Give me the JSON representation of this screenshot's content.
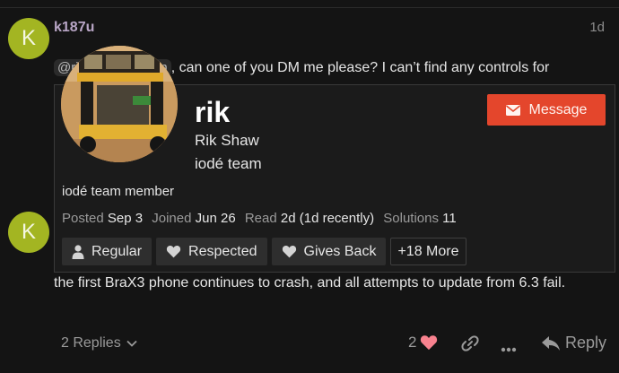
{
  "post1": {
    "avatar_letter": "K",
    "username": "k187u",
    "date": "1d",
    "mention": "@rik",
    "mention_tail": "men",
    "text": ", can one of you DM me please? I can’t find any controls for"
  },
  "post2": {
    "avatar_letter": "K",
    "text": "the first BraX3 phone continues to crash, and all attempts to update from 6.3 fail."
  },
  "user_card": {
    "username": "rik",
    "full_name": "Rik Shaw",
    "title": "iodé team",
    "bio": "iodé team member",
    "message_label": "Message",
    "meta": {
      "posted_label": "Posted",
      "posted_value": "Sep 3",
      "joined_label": "Joined",
      "joined_value": "Jun 26",
      "read_label": "Read",
      "read_value": "2d (1d recently)",
      "solutions_label": "Solutions",
      "solutions_value": "11"
    },
    "badges": [
      "Regular",
      "Respected",
      "Gives Back"
    ],
    "more_badges": "+18 More"
  },
  "footer": {
    "replies_label": "2 Replies",
    "like_count": "2",
    "reply_label": "Reply"
  },
  "colors": {
    "background": "#141414",
    "avatar": "#a3b522",
    "username": "#b9a6c6",
    "accent": "#e4462c",
    "heart": "#f9828f"
  },
  "icons": [
    "user-icon",
    "heart-icon",
    "envelope-icon",
    "chevron-down-icon",
    "link-icon",
    "ellipsis-icon",
    "reply-icon"
  ]
}
